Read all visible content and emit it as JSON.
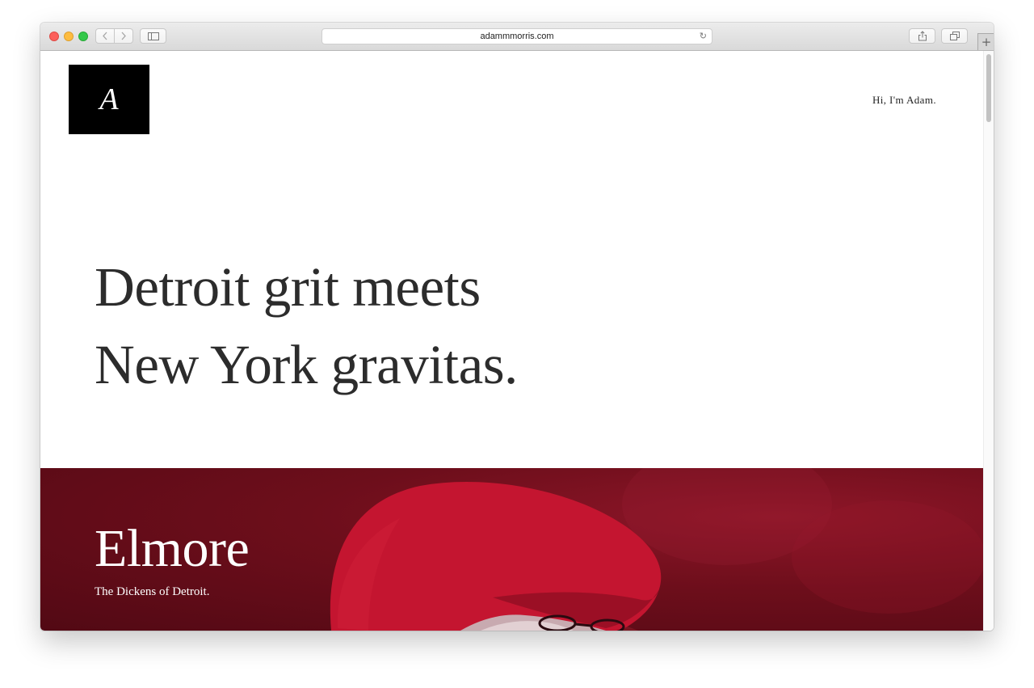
{
  "browser": {
    "url": "adammmorris.com",
    "new_tab_symbol": "+",
    "reload_symbol": "↻"
  },
  "site": {
    "logo_letter": "A",
    "nav_link": "Hi, I'm Adam.",
    "hero_line1": "Detroit grit meets",
    "hero_line2": "New York gravitas.",
    "feature": {
      "title": "Elmore",
      "subtitle": "The Dickens of Detroit."
    }
  },
  "colors": {
    "feature_background": "#6d0e1b",
    "hat": "#c41530",
    "logo_background": "#000000",
    "hero_text": "#2c2c2c"
  }
}
